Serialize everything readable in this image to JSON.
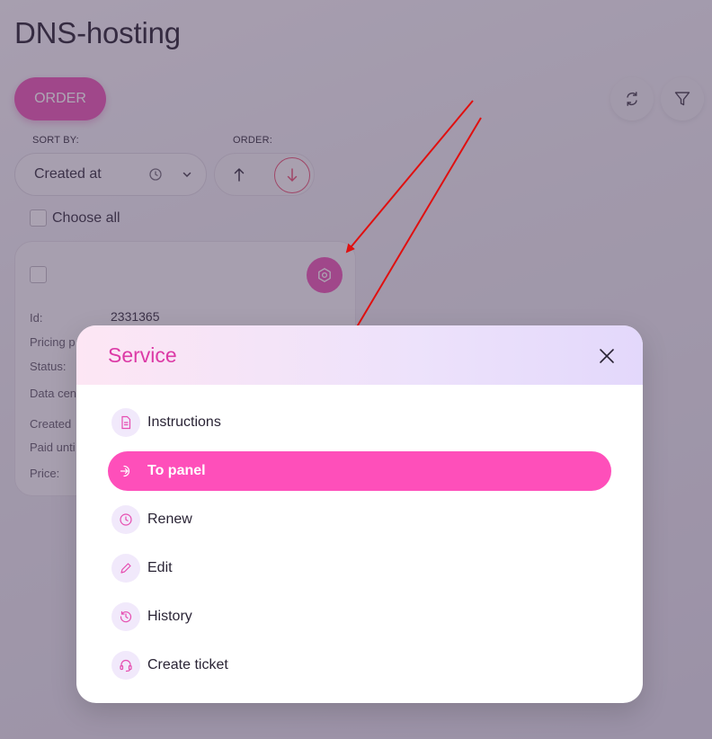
{
  "page": {
    "title": "DNS-hosting"
  },
  "toolbar": {
    "order_label": "ORDER",
    "refresh_icon": "refresh-icon",
    "filter_icon": "filter-icon"
  },
  "sort": {
    "sort_by_label": "SORT BY:",
    "selected": "Created at",
    "order_label": "ORDER:",
    "order_selected": "desc"
  },
  "choose_all_label": "Choose all",
  "card": {
    "fields": [
      {
        "label": "Id:",
        "value": "2331365"
      },
      {
        "label": "Pricing p",
        "value": ""
      },
      {
        "label": "Status:",
        "value": ""
      },
      {
        "label": "Data cen",
        "value": ""
      },
      {
        "label": "Created",
        "value": ""
      },
      {
        "label": "Paid unti",
        "value": ""
      },
      {
        "label": "Price:",
        "value": ""
      }
    ]
  },
  "modal": {
    "title": "Service",
    "items": [
      {
        "label": "Instructions",
        "icon": "document-icon",
        "active": false
      },
      {
        "label": "To panel",
        "icon": "enter-panel-icon",
        "active": true
      },
      {
        "label": "Renew",
        "icon": "clock-icon",
        "active": false
      },
      {
        "label": "Edit",
        "icon": "pencil-icon",
        "active": false
      },
      {
        "label": "History",
        "icon": "history-icon",
        "active": false
      },
      {
        "label": "Create ticket",
        "icon": "headset-icon",
        "active": false
      }
    ]
  },
  "colors": {
    "accent": "#e64db0",
    "active_item": "#fe4fba",
    "modal_title": "#dc3aa6",
    "annotation_arrow": "#e01010"
  }
}
